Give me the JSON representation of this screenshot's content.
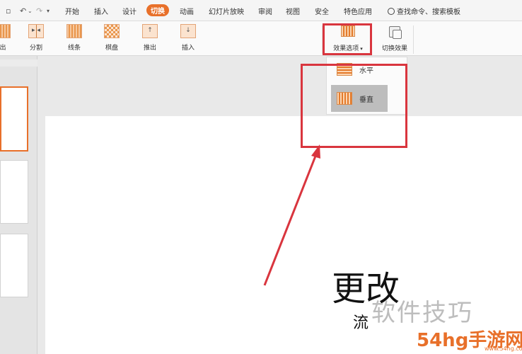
{
  "menubar": {
    "tabs": [
      {
        "label": "开始"
      },
      {
        "label": "插入"
      },
      {
        "label": "设计"
      },
      {
        "label": "切换"
      },
      {
        "label": "动画"
      },
      {
        "label": "幻灯片放映"
      },
      {
        "label": "审阅"
      },
      {
        "label": "视图"
      },
      {
        "label": "安全"
      },
      {
        "label": "特色应用"
      }
    ],
    "active_tab": "切换",
    "search_label": "查找命令、搜索模板"
  },
  "ribbon": {
    "buttons": [
      {
        "label": "出"
      },
      {
        "label": "分割"
      },
      {
        "label": "线条"
      },
      {
        "label": "棋盘"
      },
      {
        "label": "推出"
      },
      {
        "label": "插入"
      }
    ],
    "effect_options_label": "效果选项",
    "effect_options_caret": "▾",
    "switch_effect_label": "切换效果"
  },
  "dropdown": {
    "items": [
      {
        "label": "水平",
        "selected": false
      },
      {
        "label": "垂直",
        "selected": true
      }
    ]
  },
  "slide": {
    "title": "更改",
    "subtitle": "流"
  },
  "watermark": {
    "line1": "软件技巧",
    "line2": "54hg手游网",
    "line3": "www.54hg.com"
  },
  "colors": {
    "accent": "#e8702a",
    "highlight": "#d9353e"
  }
}
